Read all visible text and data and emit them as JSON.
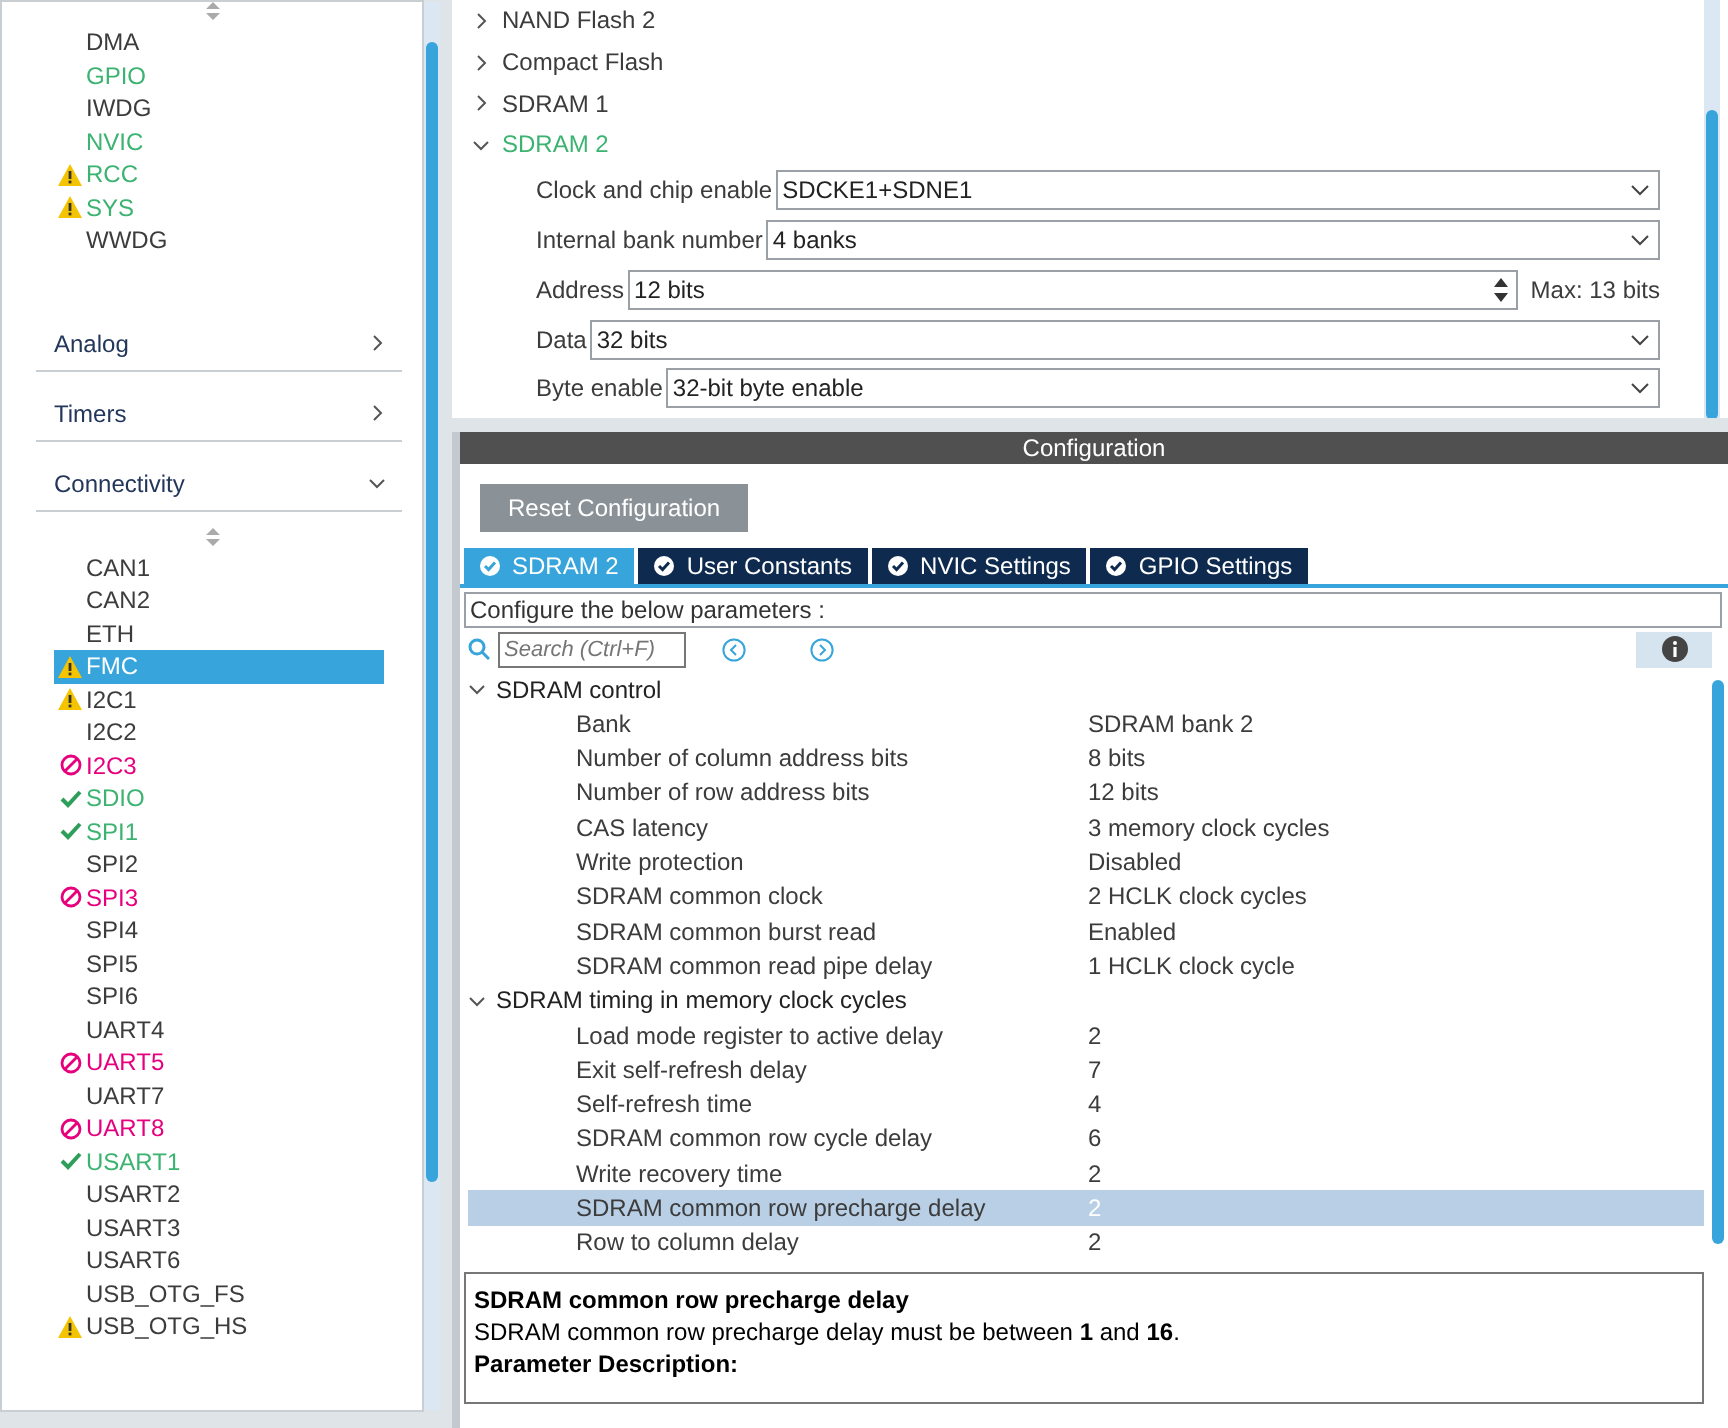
{
  "sidebar": {
    "system_items": [
      {
        "label": "DMA",
        "kind": "plain",
        "selected": false
      },
      {
        "label": "GPIO",
        "kind": "configured",
        "selected": false
      },
      {
        "label": "IWDG",
        "kind": "plain",
        "selected": false
      },
      {
        "label": "NVIC",
        "kind": "configured",
        "selected": false
      },
      {
        "label": "RCC",
        "kind": "warning_configured",
        "selected": false
      },
      {
        "label": "SYS",
        "kind": "warning_configured",
        "selected": false
      },
      {
        "label": "WWDG",
        "kind": "plain",
        "selected": false
      }
    ],
    "categories": [
      {
        "label": "Analog",
        "expanded": false
      },
      {
        "label": "Timers",
        "expanded": false
      },
      {
        "label": "Connectivity",
        "expanded": true
      }
    ],
    "connectivity_items": [
      {
        "label": "CAN1",
        "kind": "plain",
        "selected": false
      },
      {
        "label": "CAN2",
        "kind": "plain",
        "selected": false
      },
      {
        "label": "ETH",
        "kind": "plain",
        "selected": false
      },
      {
        "label": "FMC",
        "kind": "warning",
        "selected": true
      },
      {
        "label": "I2C1",
        "kind": "warning",
        "selected": false
      },
      {
        "label": "I2C2",
        "kind": "plain",
        "selected": false
      },
      {
        "label": "I2C3",
        "kind": "conflict",
        "selected": false
      },
      {
        "label": "SDIO",
        "kind": "ok",
        "selected": false
      },
      {
        "label": "SPI1",
        "kind": "ok",
        "selected": false
      },
      {
        "label": "SPI2",
        "kind": "plain",
        "selected": false
      },
      {
        "label": "SPI3",
        "kind": "conflict",
        "selected": false
      },
      {
        "label": "SPI4",
        "kind": "plain",
        "selected": false
      },
      {
        "label": "SPI5",
        "kind": "plain",
        "selected": false
      },
      {
        "label": "SPI6",
        "kind": "plain",
        "selected": false
      },
      {
        "label": "UART4",
        "kind": "plain",
        "selected": false
      },
      {
        "label": "UART5",
        "kind": "conflict",
        "selected": false
      },
      {
        "label": "UART7",
        "kind": "plain",
        "selected": false
      },
      {
        "label": "UART8",
        "kind": "conflict",
        "selected": false
      },
      {
        "label": "USART1",
        "kind": "ok",
        "selected": false
      },
      {
        "label": "USART2",
        "kind": "plain",
        "selected": false
      },
      {
        "label": "USART3",
        "kind": "plain",
        "selected": false
      },
      {
        "label": "USART6",
        "kind": "plain",
        "selected": false
      },
      {
        "label": "USB_OTG_FS",
        "kind": "plain",
        "selected": false
      },
      {
        "label": "USB_OTG_HS",
        "kind": "warning",
        "selected": false
      }
    ]
  },
  "mode_tree": [
    {
      "label": "NAND Flash 2",
      "expanded": false,
      "configured": false
    },
    {
      "label": "Compact Flash",
      "expanded": false,
      "configured": false
    },
    {
      "label": "SDRAM 1",
      "expanded": false,
      "configured": false
    },
    {
      "label": "SDRAM 2",
      "expanded": true,
      "configured": true
    }
  ],
  "mode_fields": [
    {
      "label": "Clock and chip enable",
      "value": "SDCKE1+SDNE1",
      "kind": "select"
    },
    {
      "label": "Internal bank number",
      "value": "4 banks",
      "kind": "select"
    },
    {
      "label": "Address",
      "value": "12 bits",
      "kind": "spinner",
      "note": "Max: 13 bits"
    },
    {
      "label": "Data",
      "value": "32 bits",
      "kind": "select"
    },
    {
      "label": "Byte enable",
      "value": "32-bit byte enable",
      "kind": "select"
    }
  ],
  "configuration": {
    "title": "Configuration",
    "reset_button": "Reset Configuration",
    "tabs": [
      {
        "label": "SDRAM 2",
        "selected": true
      },
      {
        "label": "User Constants",
        "selected": false
      },
      {
        "label": "NVIC Settings",
        "selected": false
      },
      {
        "label": "GPIO Settings",
        "selected": false
      }
    ],
    "hint": "Configure the below parameters :",
    "search": {
      "placeholder": "Search (Ctrl+F)"
    },
    "groups": [
      {
        "label": "SDRAM control",
        "expanded": true,
        "children": [
          {
            "name": "Bank",
            "value": "SDRAM bank 2",
            "selected": false
          },
          {
            "name": "Number of column address bits",
            "value": "8 bits",
            "selected": false
          },
          {
            "name": "Number of row address bits",
            "value": "12 bits",
            "selected": false
          },
          {
            "name": "CAS latency",
            "value": "3 memory clock cycles",
            "selected": false
          },
          {
            "name": "Write protection",
            "value": "Disabled",
            "selected": false
          },
          {
            "name": "SDRAM common clock",
            "value": "2 HCLK clock cycles",
            "selected": false
          },
          {
            "name": "SDRAM common burst read",
            "value": "Enabled",
            "selected": false
          },
          {
            "name": "SDRAM common read pipe delay",
            "value": "1 HCLK clock cycle",
            "selected": false
          }
        ]
      },
      {
        "label": "SDRAM timing in memory clock cycles",
        "expanded": true,
        "children": [
          {
            "name": "Load mode register to active delay",
            "value": "2",
            "selected": false
          },
          {
            "name": "Exit self-refresh delay",
            "value": "7",
            "selected": false
          },
          {
            "name": "Self-refresh time",
            "value": "4",
            "selected": false
          },
          {
            "name": "SDRAM common row cycle delay",
            "value": "6",
            "selected": false
          },
          {
            "name": "Write recovery time",
            "value": "2",
            "selected": false
          },
          {
            "name": "SDRAM common row precharge delay",
            "value": "2",
            "selected": true
          },
          {
            "name": "Row to column delay",
            "value": "2",
            "selected": false
          }
        ]
      }
    ],
    "description": {
      "title": "SDRAM common row precharge delay",
      "text": "SDRAM common row precharge delay must be between **1** and **16**.",
      "footer": "Parameter Description:"
    }
  }
}
